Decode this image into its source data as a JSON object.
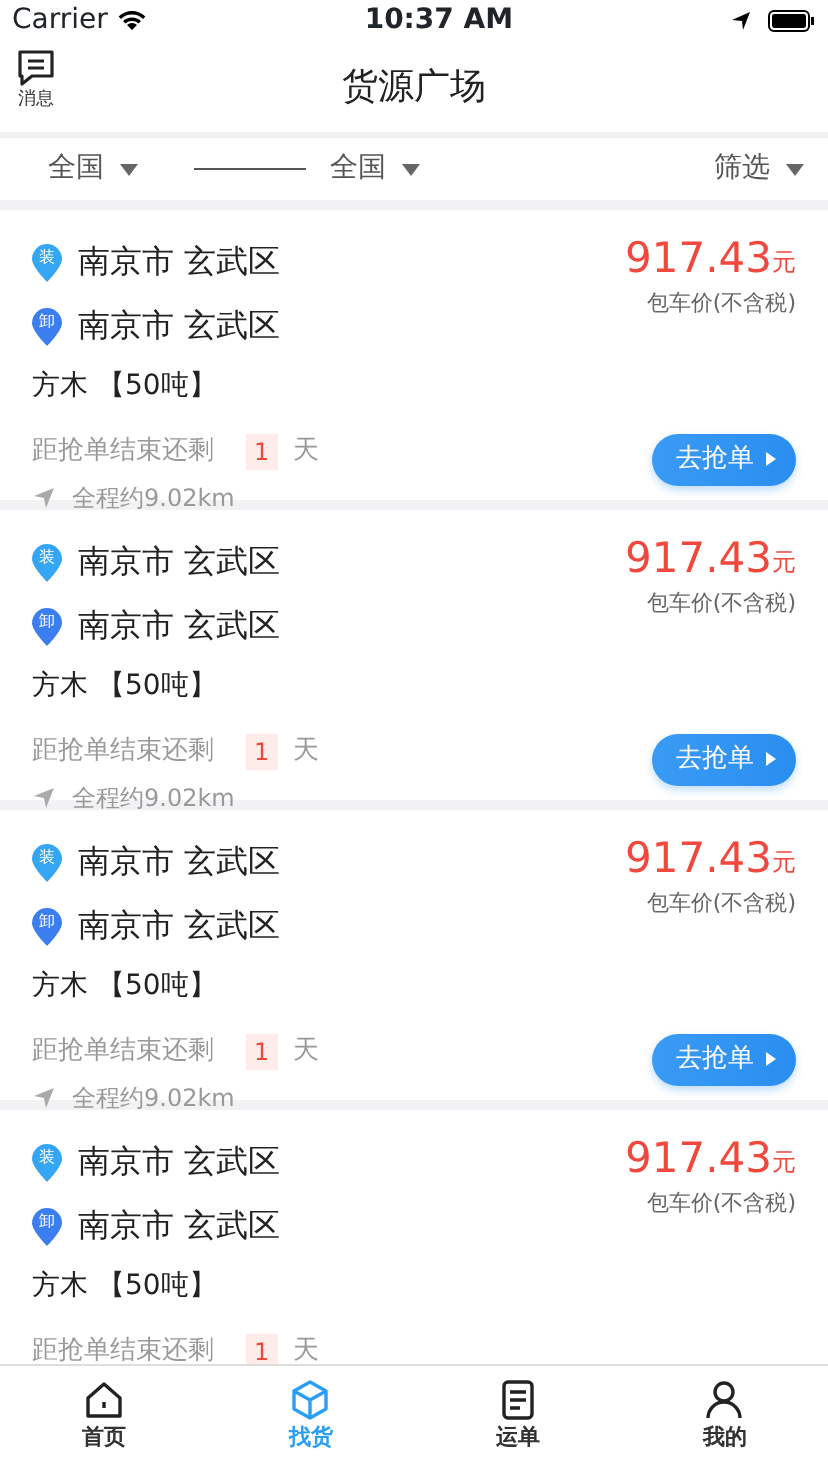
{
  "status_bar": {
    "carrier": "Carrier",
    "time": "10:37 AM"
  },
  "nav": {
    "title": "货源广场",
    "message_label": "消息"
  },
  "filters": [
    {
      "kind": "from",
      "label": "全国"
    },
    {
      "kind": "to",
      "label": "全国"
    },
    {
      "kind": "filter",
      "label": "筛选"
    }
  ],
  "cards": [
    {
      "load_badge": "装",
      "load_place": "南京市 玄武区",
      "unload_badge": "卸",
      "unload_place": "南京市 玄武区",
      "price": "917.43",
      "price_unit": "元",
      "price_note": "包车价(不含税)",
      "cargo": "方木 【50吨】",
      "countdown_label": "距抢单结束还剩",
      "countdown_value": "1",
      "countdown_unit": "天",
      "distance": "全程约9.02km",
      "button": "去抢单"
    },
    {
      "load_badge": "装",
      "load_place": "南京市 玄武区",
      "unload_badge": "卸",
      "unload_place": "南京市 玄武区",
      "price": "917.43",
      "price_unit": "元",
      "price_note": "包车价(不含税)",
      "cargo": "方木 【50吨】",
      "countdown_label": "距抢单结束还剩",
      "countdown_value": "1",
      "countdown_unit": "天",
      "distance": "全程约9.02km",
      "button": "去抢单"
    },
    {
      "load_badge": "装",
      "load_place": "南京市 玄武区",
      "unload_badge": "卸",
      "unload_place": "南京市 玄武区",
      "price": "917.43",
      "price_unit": "元",
      "price_note": "包车价(不含税)",
      "cargo": "方木 【50吨】",
      "countdown_label": "距抢单结束还剩",
      "countdown_value": "1",
      "countdown_unit": "天",
      "distance": "全程约9.02km",
      "button": "去抢单"
    },
    {
      "load_badge": "装",
      "load_place": "南京市 玄武区",
      "unload_badge": "卸",
      "unload_place": "南京市 玄武区",
      "price": "917.43",
      "price_unit": "元",
      "price_note": "包车价(不含税)",
      "cargo": "方木 【50吨】",
      "countdown_label": "距抢单结束还剩",
      "countdown_value": "1",
      "countdown_unit": "天"
    }
  ],
  "tabbar": [
    {
      "kind": "home",
      "label": "首页",
      "selected": false
    },
    {
      "kind": "cargo",
      "label": "找货",
      "selected": true
    },
    {
      "kind": "waybill",
      "label": "运单",
      "selected": false
    },
    {
      "kind": "mine",
      "label": "我的",
      "selected": false
    }
  ]
}
